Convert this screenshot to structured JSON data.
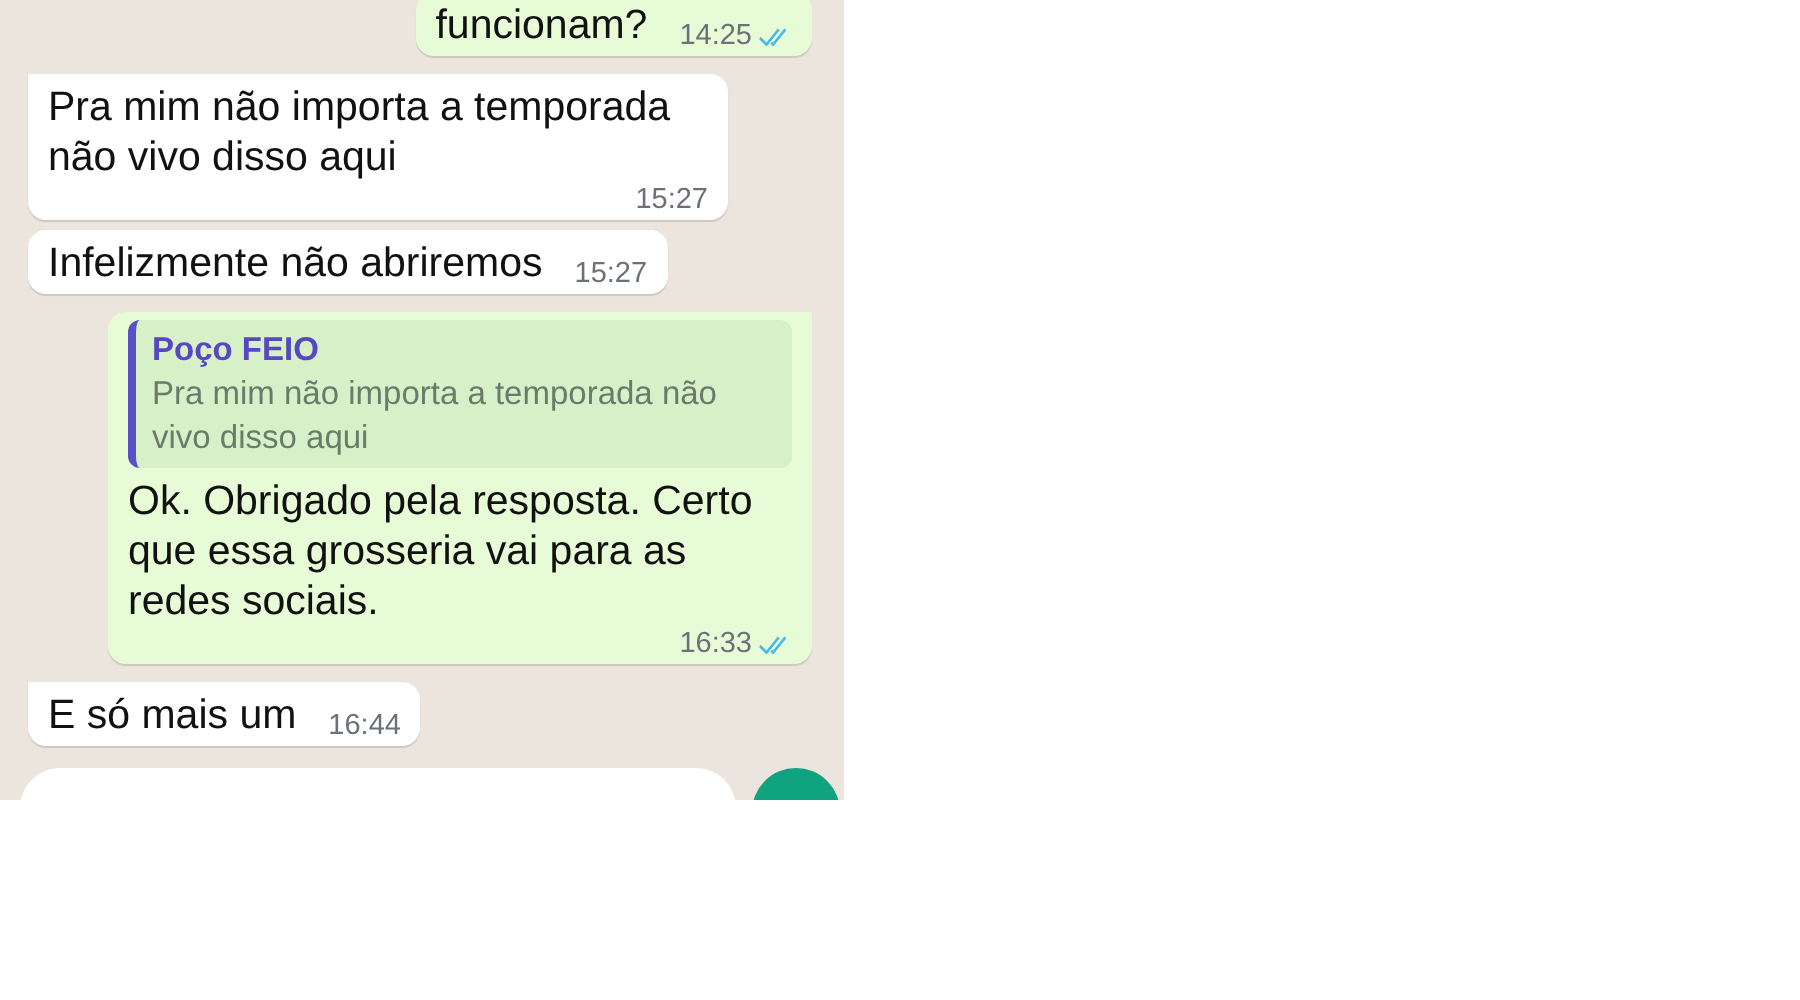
{
  "messages": [
    {
      "kind": "outgoing",
      "text": "funcionam?",
      "time": "14:25",
      "read": true
    },
    {
      "kind": "incoming",
      "text": "Pra mim não importa a temporada não vivo disso aqui",
      "time": "15:27",
      "tail": true
    },
    {
      "kind": "incoming",
      "text": "Infelizmente não abriremos",
      "time": "15:27",
      "tail": false
    },
    {
      "kind": "outgoing",
      "reply": {
        "author": "Poço FEIO",
        "text": "Pra mim não importa a temporada não vivo disso aqui"
      },
      "text": "Ok. Obrigado pela resposta. Certo que essa grosseria vai para as redes sociais.",
      "time": "16:33",
      "read": true,
      "tail": true
    },
    {
      "kind": "incoming",
      "text": "E só mais um",
      "time": "16:44",
      "tail": true
    }
  ]
}
